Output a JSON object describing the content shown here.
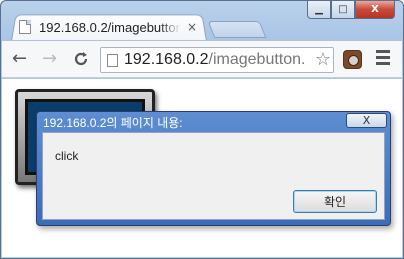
{
  "browser": {
    "tab": {
      "title": "192.168.0.2/imagebutton",
      "close_glyph": "×"
    },
    "new_tab": {
      "icon": "new-tab-icon"
    },
    "caption": {
      "minimize_glyph": "▁",
      "maximize_glyph": "□",
      "close_glyph": "X"
    },
    "toolbar": {
      "back_glyph": "←",
      "forward_glyph": "→",
      "reload_glyph": "C",
      "url_host": "192.168.0.2",
      "url_path": "/imagebutton.html",
      "star_glyph": "☆",
      "extension_icon": "camera-icon",
      "menu_icon": "hamburger-menu-icon"
    }
  },
  "page": {
    "image_button": {
      "color": "#0a3d6b"
    }
  },
  "dialog": {
    "title": "192.168.0.2의 페이지 내용:",
    "close_glyph": "X",
    "message": "click",
    "ok_label": "확인"
  }
}
